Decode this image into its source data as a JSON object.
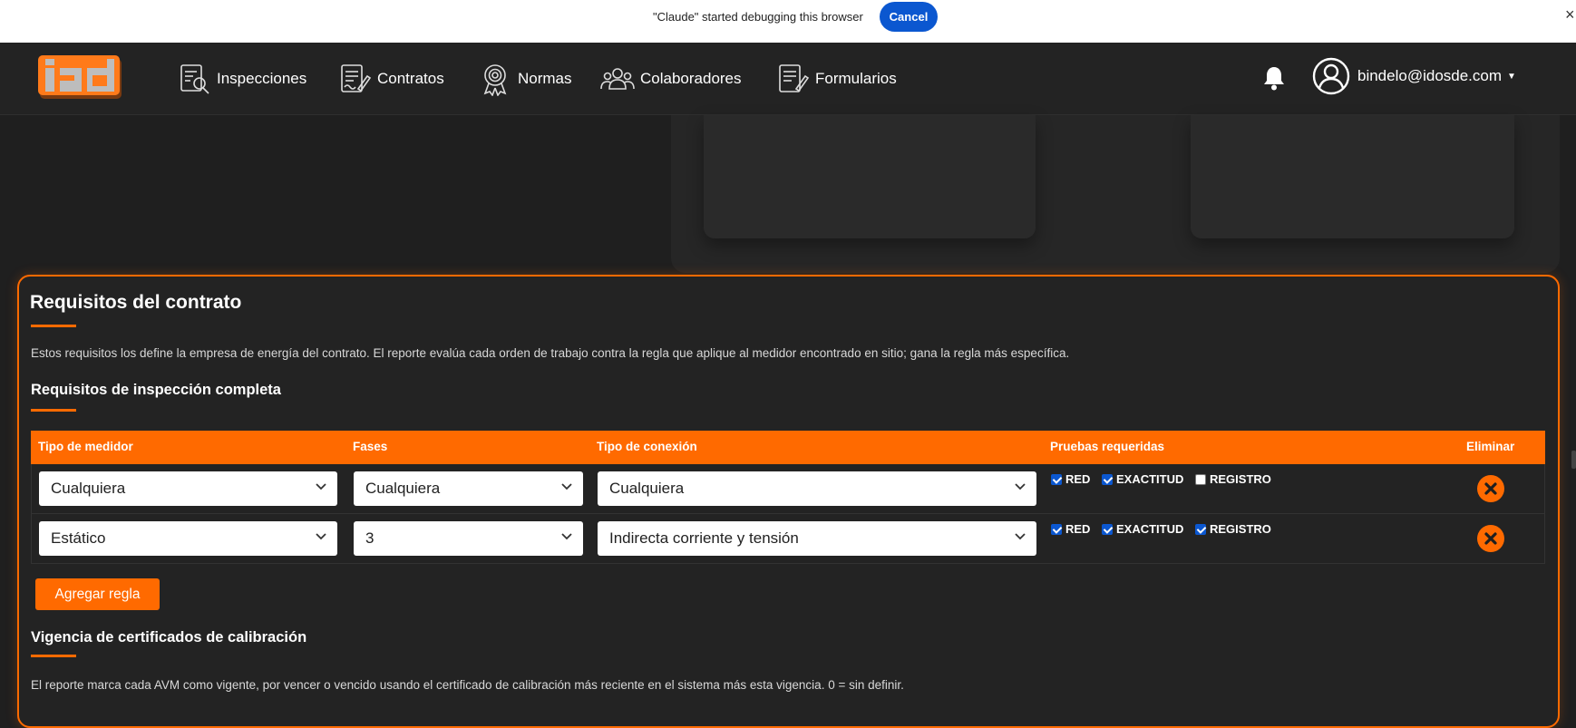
{
  "debug_bar": {
    "message": "\"Claude\" started debugging this browser",
    "cancel_label": "Cancel",
    "close_glyph": "×"
  },
  "nav": {
    "logo_icon": "iad-logo",
    "items": [
      {
        "label": "Inspecciones",
        "icon": "inspection-icon"
      },
      {
        "label": "Contratos",
        "icon": "contract-icon"
      },
      {
        "label": "Normas",
        "icon": "award-icon"
      },
      {
        "label": "Colaboradores",
        "icon": "people-icon"
      },
      {
        "label": "Formularios",
        "icon": "form-icon"
      }
    ],
    "bell_icon": "bell-icon",
    "user_email": "bindelo@idosde.com"
  },
  "requirements": {
    "title": "Requisitos del contrato",
    "description": "Estos requisitos los define la empresa de energía del contrato. El reporte evalúa cada orden de trabajo contra la regla que aplique al medidor encontrado en sitio; gana la regla más específica.",
    "inspection_title": "Requisitos de inspección completa",
    "columns": [
      "Tipo de medidor",
      "Fases",
      "Tipo de conexión",
      "Pruebas requeridas",
      "Eliminar"
    ],
    "rows": [
      {
        "meter_type": "Cualquiera",
        "phases": "Cualquiera",
        "connection": "Cualquiera",
        "tests": [
          {
            "label": "RED",
            "checked": true
          },
          {
            "label": "EXACTITUD",
            "checked": true
          },
          {
            "label": "REGISTRO",
            "checked": false
          }
        ]
      },
      {
        "meter_type": "Estático",
        "phases": "3",
        "connection": "Indirecta corriente y tensión",
        "tests": [
          {
            "label": "RED",
            "checked": true
          },
          {
            "label": "EXACTITUD",
            "checked": true
          },
          {
            "label": "REGISTRO",
            "checked": true
          }
        ]
      }
    ],
    "add_rule_label": "Agregar regla",
    "calibration_title": "Vigencia de certificados de calibración",
    "calibration_description": "El reporte marca cada AVM como vigente, por vencer o vencido usando el certificado de calibración más reciente en el sistema más esta vigencia. 0 = sin definir."
  },
  "colors": {
    "accent": "#ff6a00",
    "background": "#1f1f1f",
    "card": "#232323",
    "cancel_blue": "#0b57d0"
  }
}
